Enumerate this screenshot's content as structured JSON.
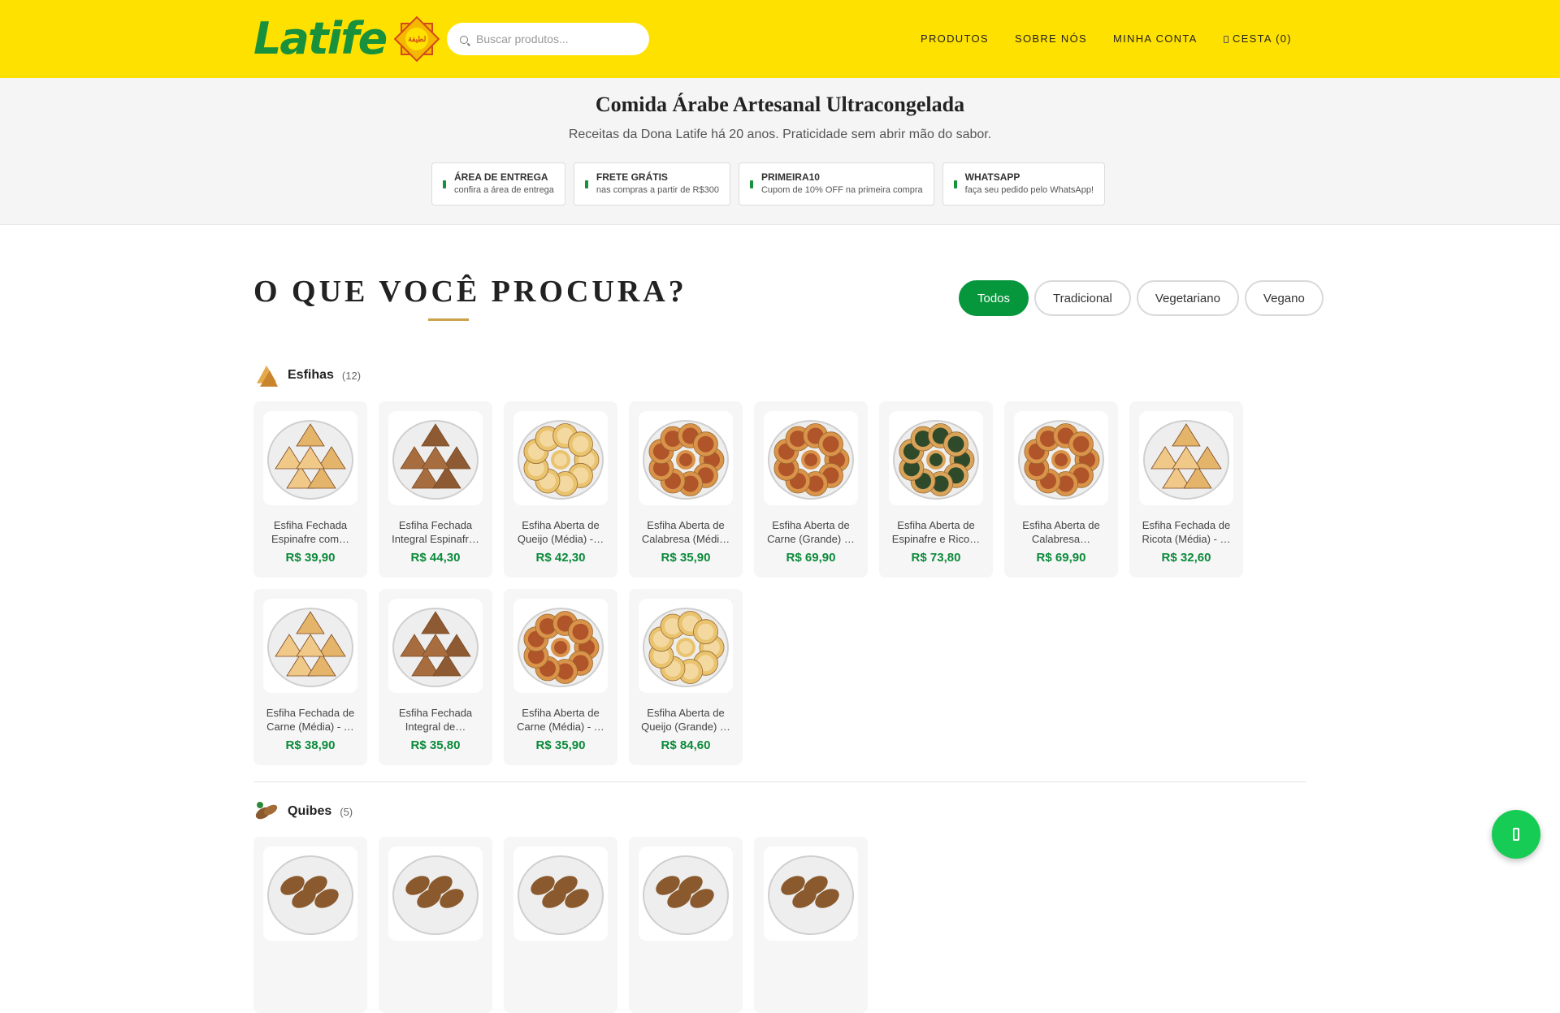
{
  "header": {
    "logo_text": "Latife",
    "logo_badge_text": "لطيفة",
    "search_placeholder": "Buscar produtos...",
    "nav": [
      "PRODUTOS",
      "SOBRE NÓS",
      "MINHA CONTA",
      "CESTA (0)"
    ]
  },
  "hero": {
    "title": "Comida Árabe Artesanal Ultracongelada",
    "subtitle": "Receitas da Dona Latife há 20 anos. Praticidade sem abrir mão do sabor.",
    "features": [
      {
        "title": "ÁREA DE ENTREGA",
        "desc": "confira a área de entrega",
        "icon": "location-icon"
      },
      {
        "title": "FRETE GRÁTIS",
        "desc": "nas compras a partir de R$300",
        "icon": "truck-icon"
      },
      {
        "title": "PRIMEIRA10",
        "desc": "Cupom de 10% OFF na primeira compra",
        "icon": "tag-icon"
      },
      {
        "title": "WHATSAPP",
        "desc": "faça seu pedido pelo WhatsApp!",
        "icon": "whatsapp-icon"
      }
    ]
  },
  "catalog": {
    "title": "O QUE VOCÊ PROCURA?",
    "filters": [
      "Todos",
      "Tradicional",
      "Vegetariano",
      "Vegano"
    ],
    "active_filter": "Todos",
    "groups": [
      {
        "name": "Esfihas",
        "count": "(12)",
        "products": [
          {
            "title": "Esfiha Fechada Espinafre com…",
            "price": "R$ 39,90",
            "kind": "closed-light"
          },
          {
            "title": "Esfiha Fechada Integral Espinafr…",
            "price": "R$ 44,30",
            "kind": "closed-dark"
          },
          {
            "title": "Esfiha Aberta de Queijo (Média) -…",
            "price": "R$ 42,30",
            "kind": "open-cheese"
          },
          {
            "title": "Esfiha Aberta de Calabresa (Médi…",
            "price": "R$ 35,90",
            "kind": "open-meat"
          },
          {
            "title": "Esfiha Aberta de Carne (Grande) …",
            "price": "R$ 69,90",
            "kind": "open-meat"
          },
          {
            "title": "Esfiha Aberta de Espinafre e Rico…",
            "price": "R$ 73,80",
            "kind": "open-spinach"
          },
          {
            "title": "Esfiha Aberta de Calabresa…",
            "price": "R$ 69,90",
            "kind": "open-meat"
          },
          {
            "title": "Esfiha Fechada de Ricota (Média) - …",
            "price": "R$ 32,60",
            "kind": "closed-light"
          },
          {
            "title": "Esfiha Fechada de Carne (Média) - …",
            "price": "R$ 38,90",
            "kind": "closed-light"
          },
          {
            "title": "Esfiha Fechada Integral de…",
            "price": "R$ 35,80",
            "kind": "closed-dark"
          },
          {
            "title": "Esfiha Aberta de Carne (Média) - …",
            "price": "R$ 35,90",
            "kind": "open-meat"
          },
          {
            "title": "Esfiha Aberta de Queijo (Grande) …",
            "price": "R$ 84,60",
            "kind": "open-cheese"
          }
        ]
      },
      {
        "name": "Quibes",
        "count": "(5)",
        "products": [
          {
            "title": "",
            "price": "",
            "kind": "kibbeh"
          },
          {
            "title": "",
            "price": "",
            "kind": "kibbeh"
          },
          {
            "title": "",
            "price": "",
            "kind": "kibbeh"
          },
          {
            "title": "",
            "price": "",
            "kind": "kibbeh"
          },
          {
            "title": "",
            "price": "",
            "kind": "kibbeh"
          }
        ]
      }
    ]
  },
  "colors": {
    "header_bg": "#ffe100",
    "brand_green": "#19913c",
    "price_green": "#0b8a3a",
    "whatsapp_green": "#16cc54"
  }
}
